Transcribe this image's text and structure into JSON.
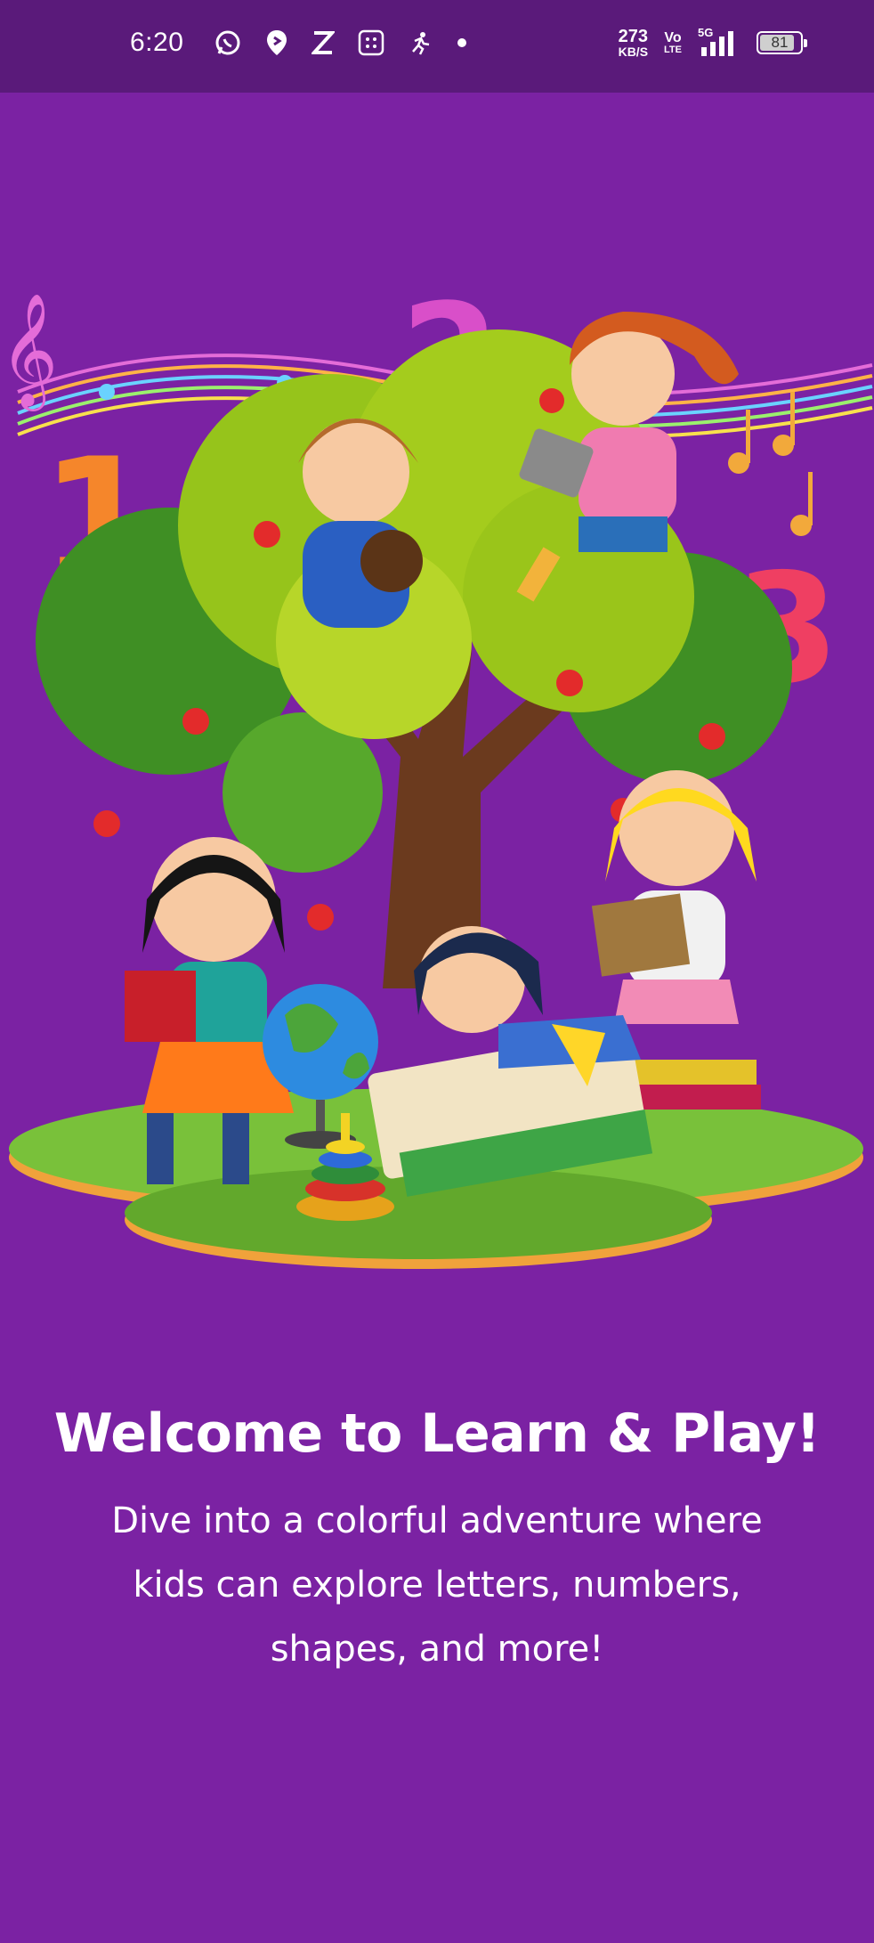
{
  "status_bar": {
    "time": "6:20",
    "net_speed_value": "273",
    "net_speed_unit": "KB/S",
    "volte_top": "Vo",
    "volte_bottom": "LTE",
    "network": "5G",
    "battery": "81",
    "icons": [
      "whatsapp-icon",
      "location-pin-icon",
      "z-app-icon",
      "grid-app-icon",
      "running-icon",
      "dot-icon"
    ]
  },
  "hero": {
    "numbers": [
      "1",
      "2",
      "3"
    ]
  },
  "welcome": {
    "title": "Welcome to Learn & Play!",
    "description": "Dive into a colorful adventure where kids can explore letters, numbers, shapes, and more!"
  },
  "colors": {
    "background": "#7b22a3",
    "status_bar": "#5a1a7a",
    "text": "#ffffff"
  }
}
